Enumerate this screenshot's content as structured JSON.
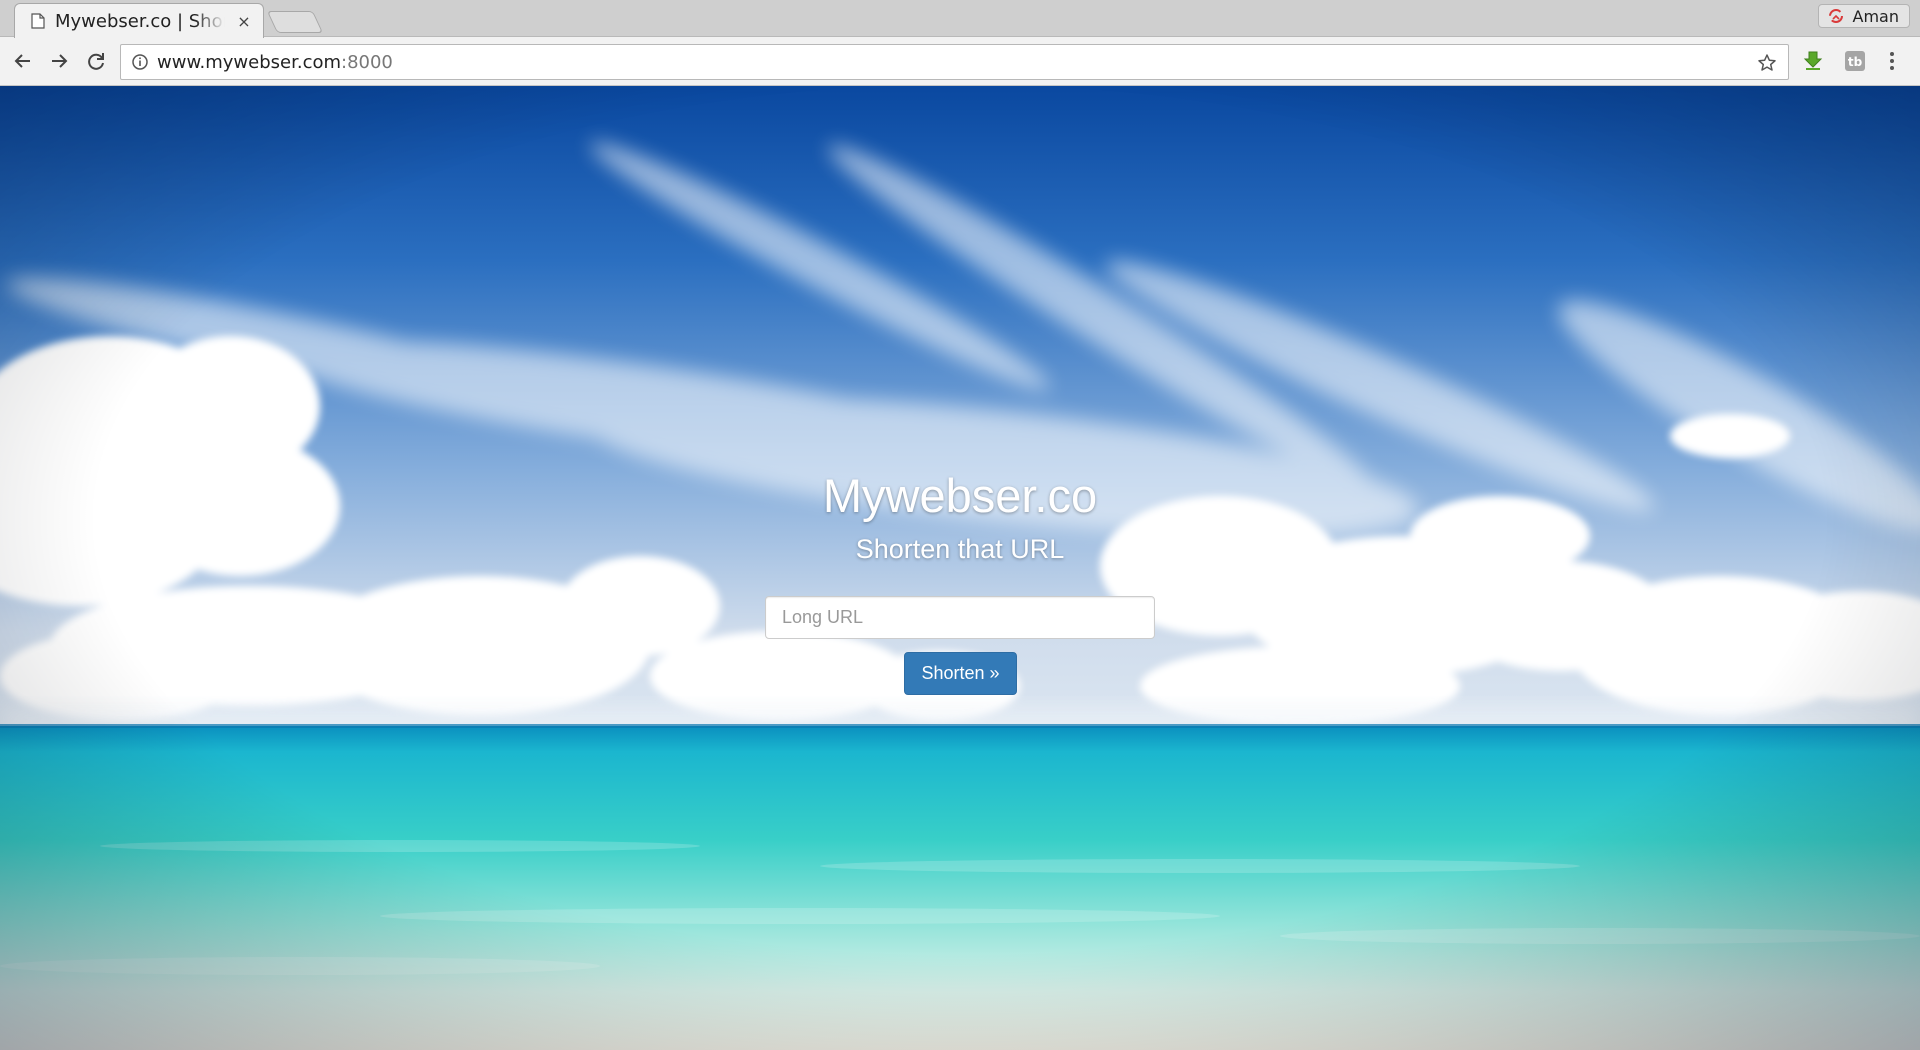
{
  "browser": {
    "tab": {
      "title": "Mywebser.co | Shorten that URL",
      "close_glyph": "×",
      "favicon": "page-icon"
    },
    "profile": {
      "name": "Aman",
      "icon": "profile-switch-icon"
    },
    "address_bar": {
      "host": "www.mywebser.com",
      "port": ":8000",
      "info_icon": "info-icon",
      "bookmark_icon": "star-icon"
    },
    "nav": {
      "back_icon": "back-arrow-icon",
      "forward_icon": "forward-arrow-icon",
      "reload_icon": "reload-icon",
      "menu_icon": "kebab-menu-icon"
    },
    "extensions": [
      {
        "name": "download-extension-icon",
        "color": "#5aa82a"
      },
      {
        "name": "tb-extension-icon",
        "label": "tb",
        "color": "#9a9a9a"
      }
    ]
  },
  "page": {
    "title": "Mywebser.co",
    "subtitle": "Shorten that URL",
    "input": {
      "placeholder": "Long URL",
      "value": ""
    },
    "button_label": "Shorten »"
  },
  "colors": {
    "button": "#337ab7",
    "button_border": "#2e6da4",
    "sky_top": "#0a4ea6",
    "sea": "#2ec4c8"
  }
}
